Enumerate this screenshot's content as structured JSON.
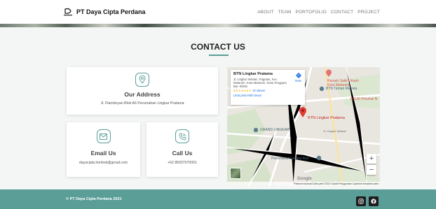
{
  "brand": {
    "name": "PT Daya Cipta Perdana",
    "logo_icon": "dcp-logo-icon"
  },
  "nav": {
    "items": [
      "ABOUT",
      "TEAM",
      "PORTOFOLIO",
      "CONTACT",
      "PROJECT"
    ]
  },
  "section": {
    "title": "CONTACT US",
    "accent_color": "#5a9e97"
  },
  "cards": {
    "address": {
      "icon": "location-pin-icon",
      "title": "Our Address",
      "text": "Jl. Flamboyan Blok A6 Perumahan Lingkar Pratama"
    },
    "email": {
      "icon": "envelope-icon",
      "title": "Email Us",
      "text": "dayacipta.lombok@gmail.com"
    },
    "call": {
      "icon": "phone-icon",
      "title": "Call Us",
      "text": "+62 85937070001"
    }
  },
  "map": {
    "place_name": "BTN Lingkar Pratama",
    "place_address": "Jl. Lingkar Selatan, Pagutan, Kec. Mataram, Kota Mataram, Nusa Tenggara Bar. 83361",
    "rating": "4.5",
    "stars": "★★★★★",
    "reviews": "19 ulasan",
    "larger_map_link": "Lihat peta lebih besar",
    "route_label": "Rute",
    "marker_label": "BTN Lingkar Pratama",
    "labels": {
      "hospital": "Rumah Sakit Umum",
      "hospital2": "Kota Mataram",
      "btn_mutiara": "BTN Taman Mutiara",
      "rsud": "RSUD Provinsi N",
      "grand": "GRAND LINGKAR",
      "perumahan": "Perumahan Lingkar Asri",
      "lingkar_selatan": "Jl. Lingkar Selatan"
    },
    "zoom_in": "+",
    "zoom_out": "−",
    "google": "Google",
    "footer_text": "Pintasan keyboard   Data peta ©2021   Syarat Penggunaan   Laporkan kesalahan peta"
  },
  "footer": {
    "copyright": "© PT Daya Cipta Perdana 2021",
    "background": "#5a9e97",
    "social": [
      "instagram-icon",
      "facebook-icon"
    ]
  }
}
